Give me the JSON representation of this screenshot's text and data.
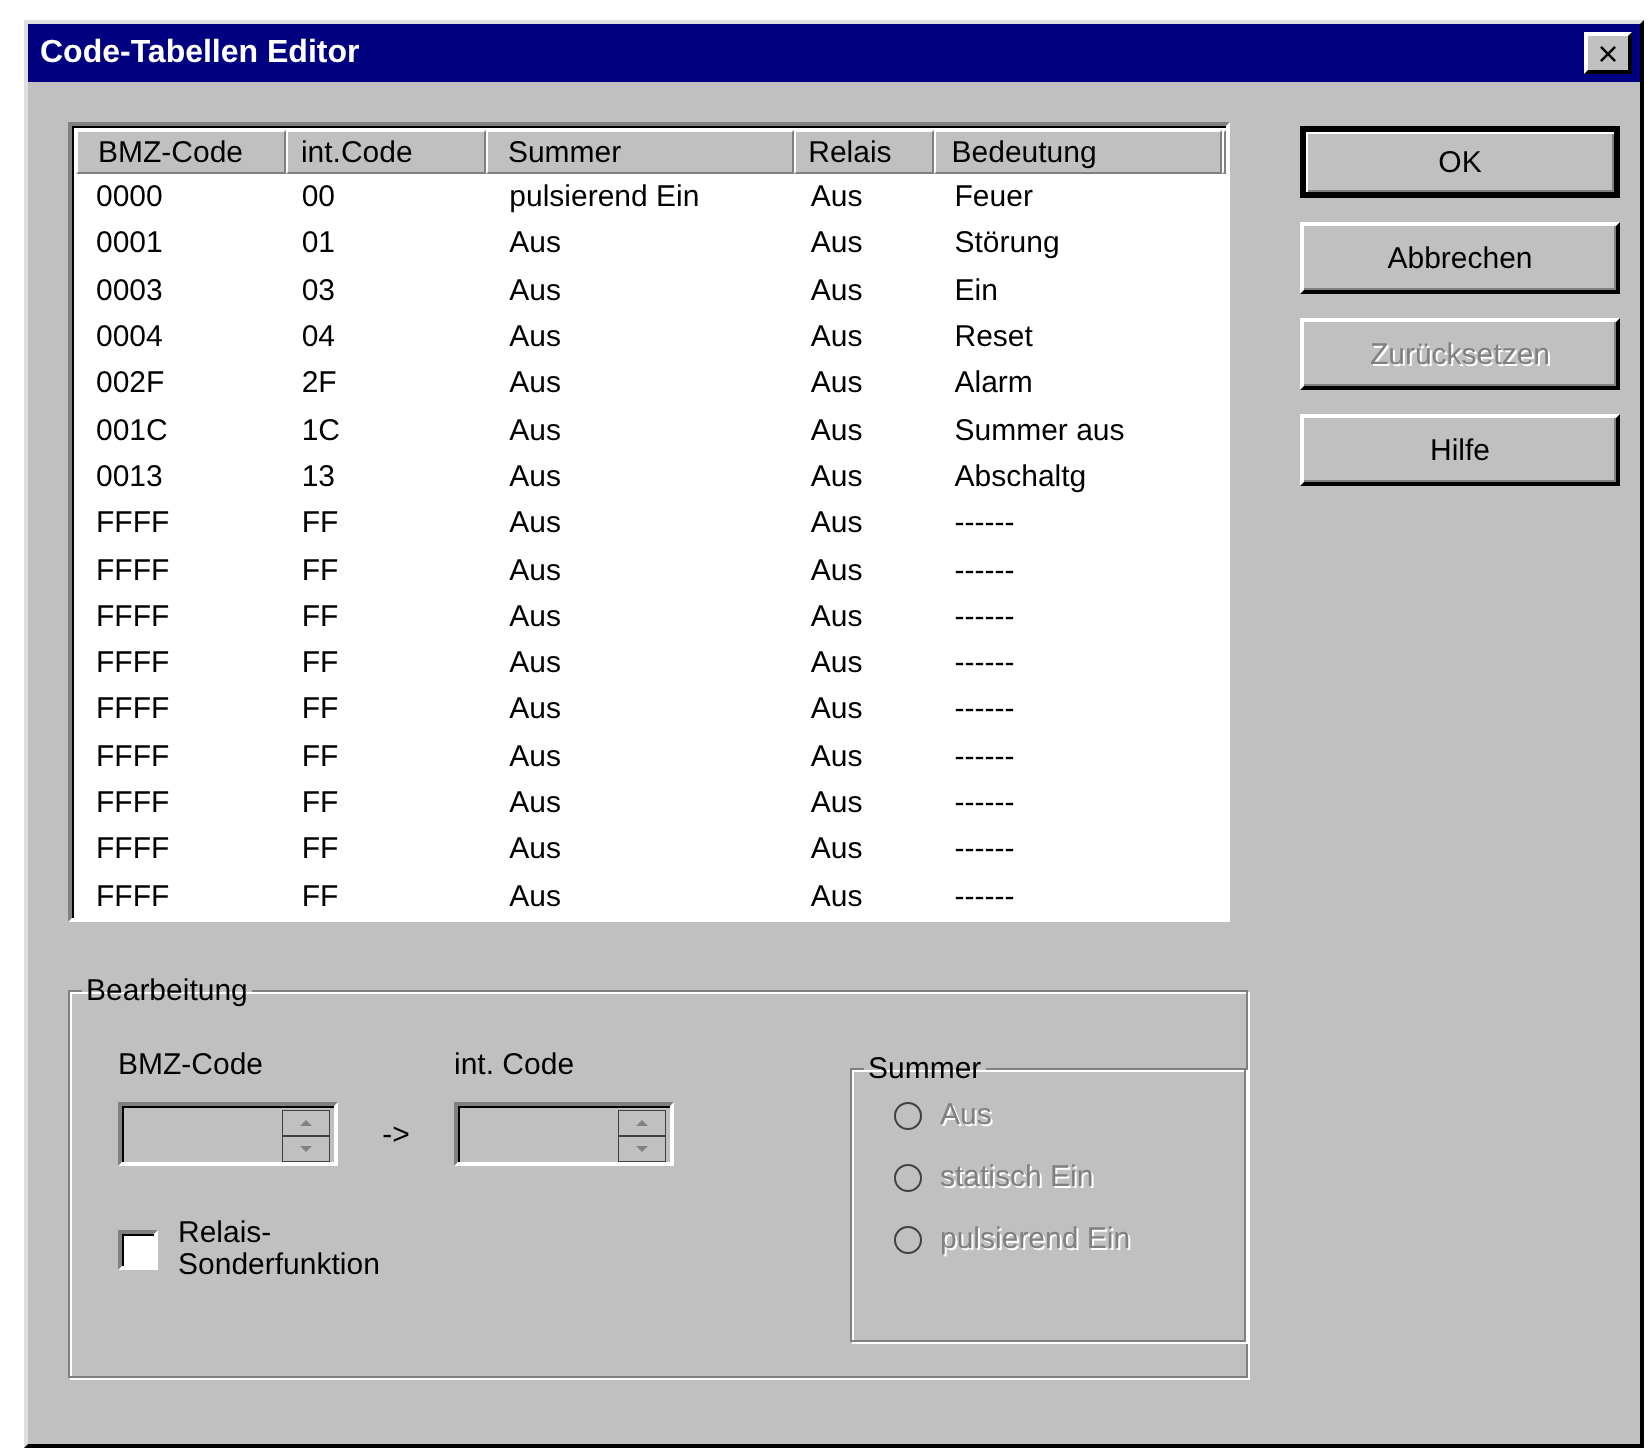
{
  "window": {
    "title": "Code-Tabellen Editor",
    "close": "×"
  },
  "table": {
    "columns": [
      "BMZ-Code",
      "int.Code",
      "Summer",
      "Relais",
      "Bedeutung"
    ],
    "rows": [
      [
        "0000",
        "00",
        "pulsierend Ein",
        "Aus",
        "Feuer"
      ],
      [
        "0001",
        "01",
        "Aus",
        "Aus",
        "Störung"
      ],
      [
        "0003",
        "03",
        "Aus",
        "Aus",
        "Ein"
      ],
      [
        "0004",
        "04",
        "Aus",
        "Aus",
        "Reset"
      ],
      [
        "002F",
        "2F",
        "Aus",
        "Aus",
        "Alarm"
      ],
      [
        "001C",
        "1C",
        "Aus",
        "Aus",
        "Summer aus"
      ],
      [
        "0013",
        "13",
        "Aus",
        "Aus",
        "Abschaltg"
      ],
      [
        "FFFF",
        "FF",
        "Aus",
        "Aus",
        "------"
      ],
      [
        "FFFF",
        "FF",
        "Aus",
        "Aus",
        "------"
      ],
      [
        "FFFF",
        "FF",
        "Aus",
        "Aus",
        "------"
      ],
      [
        "FFFF",
        "FF",
        "Aus",
        "Aus",
        "------"
      ],
      [
        "FFFF",
        "FF",
        "Aus",
        "Aus",
        "------"
      ],
      [
        "FFFF",
        "FF",
        "Aus",
        "Aus",
        "------"
      ],
      [
        "FFFF",
        "FF",
        "Aus",
        "Aus",
        "------"
      ],
      [
        "FFFF",
        "FF",
        "Aus",
        "Aus",
        "------"
      ],
      [
        "FFFF",
        "FF",
        "Aus",
        "Aus",
        "------"
      ]
    ]
  },
  "buttons": [
    {
      "label": "OK",
      "default": true,
      "disabled": false
    },
    {
      "label": "Abbrechen",
      "default": false,
      "disabled": false
    },
    {
      "label": "Zurücksetzen",
      "default": false,
      "disabled": true
    },
    {
      "label": "Hilfe",
      "default": false,
      "disabled": false
    }
  ],
  "edit": {
    "title": "Bearbeitung",
    "bmz_label": "BMZ-Code",
    "arrow": "->",
    "int_label": "int. Code",
    "bmz_field": {
      "disabled": true
    },
    "int_field": {
      "disabled": true
    },
    "relais": {
      "label": "Relais-\nSonderfunktion",
      "checked": false
    },
    "summer": {
      "title": "Summer",
      "options": [
        {
          "label": "Aus",
          "selected": false,
          "disabled": true
        },
        {
          "label": "statisch Ein",
          "selected": false,
          "disabled": true
        },
        {
          "label": "pulsierend Ein",
          "selected": false,
          "disabled": true
        }
      ]
    }
  }
}
